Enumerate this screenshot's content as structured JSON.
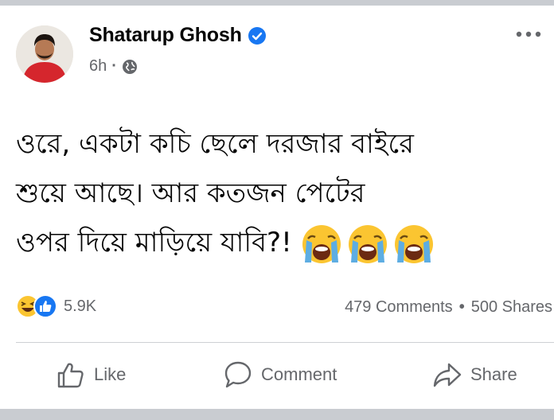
{
  "post": {
    "author": "Shatarup Ghosh",
    "time": "6h",
    "text_lines": [
      "ওরে, একটা কচি ছেলে দরজার বাইরে",
      "শুয়ে আছে। আর কতজন পেটের",
      "ওপর দিয়ে মাড়িয়ে যাবি?!"
    ],
    "emojis": [
      "crying-face-icon",
      "crying-face-icon",
      "crying-face-icon"
    ]
  },
  "reactions": {
    "icons": [
      "haha-icon",
      "like-icon"
    ],
    "count": "5.9K"
  },
  "stats": {
    "comments": "479 Comments",
    "separator": "•",
    "shares": "500 Shares"
  },
  "actions": {
    "like": "Like",
    "comment": "Comment",
    "share": "Share"
  },
  "colors": {
    "brand_blue": "#1877f2",
    "muted_text": "#65676b",
    "divider": "#ced0d4",
    "band": "#c9ccd1"
  }
}
